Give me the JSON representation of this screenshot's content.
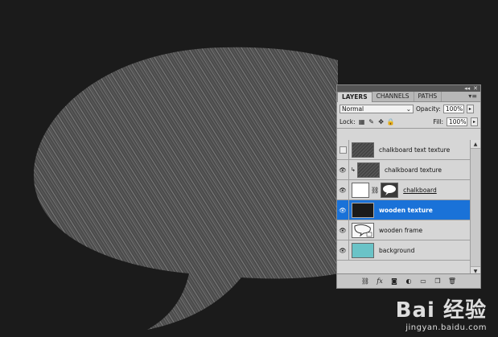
{
  "panel": {
    "tabs": [
      "LAYERS",
      "CHANNELS",
      "PATHS"
    ],
    "blend_mode": "Normal",
    "opacity_label": "Opacity:",
    "opacity_value": "100%",
    "lock_label": "Lock:",
    "fill_label": "Fill:",
    "fill_value": "100%",
    "layers": [
      {
        "name": "chalkboard text texture",
        "visible": false,
        "selected": false
      },
      {
        "name": "chalkboard texture",
        "visible": true,
        "selected": false,
        "clipped": true
      },
      {
        "name": "chalkboard",
        "visible": true,
        "selected": false,
        "has_mask": true
      },
      {
        "name": "wooden texture",
        "visible": true,
        "selected": true
      },
      {
        "name": "wooden frame",
        "visible": true,
        "selected": false,
        "smart_object": true
      },
      {
        "name": "background",
        "visible": true,
        "selected": false
      }
    ]
  },
  "watermark": {
    "logo": "Bai 经验",
    "url": "jingyan.baidu.com"
  },
  "colors": {
    "canvas_bg": "#1b1b1b",
    "selected_row": "#1a72d8",
    "background_swatch": "#6ac3c7"
  }
}
